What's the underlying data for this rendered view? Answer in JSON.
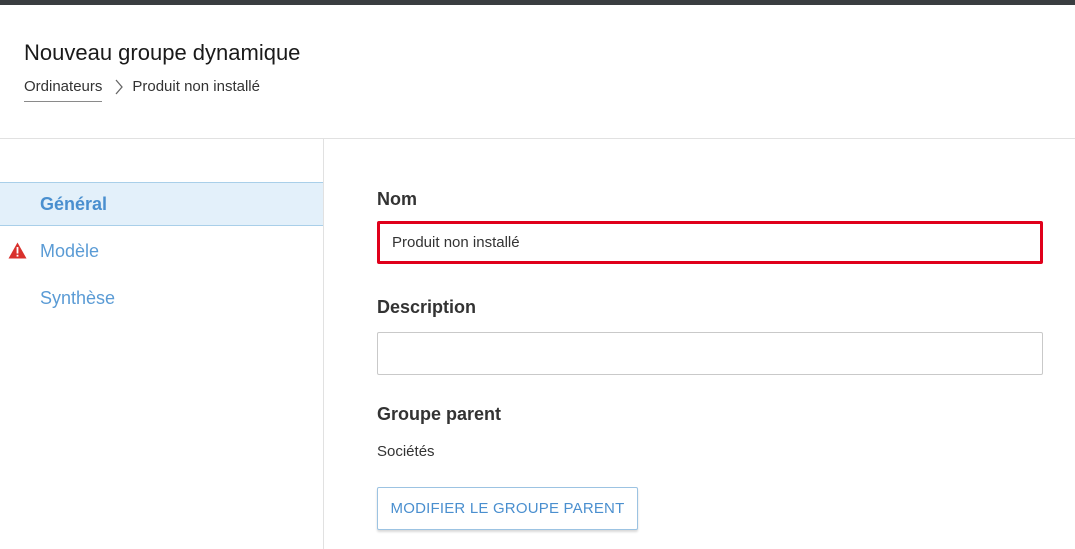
{
  "header": {
    "title": "Nouveau groupe dynamique",
    "breadcrumb": {
      "parent": "Ordinateurs",
      "separator_icon": "chevron-right-icon",
      "current": "Produit non installé"
    }
  },
  "sidebar": {
    "items": [
      {
        "label": "Général",
        "active": true
      },
      {
        "label": "Modèle",
        "warning": true,
        "icon": "warning-icon"
      },
      {
        "label": "Synthèse"
      }
    ]
  },
  "form": {
    "name": {
      "label": "Nom",
      "value": "Produit non installé"
    },
    "description": {
      "label": "Description",
      "value": ""
    },
    "parent_group": {
      "label": "Groupe parent",
      "value": "Sociétés",
      "button_label": "MODIFIER LE GROUPE PARENT"
    }
  },
  "colors": {
    "accent": "#4a8fcf",
    "active_bg": "#e3f0fa",
    "highlight_border": "#e0001b",
    "warning": "#d9302c",
    "topbar": "#3a3d40"
  }
}
